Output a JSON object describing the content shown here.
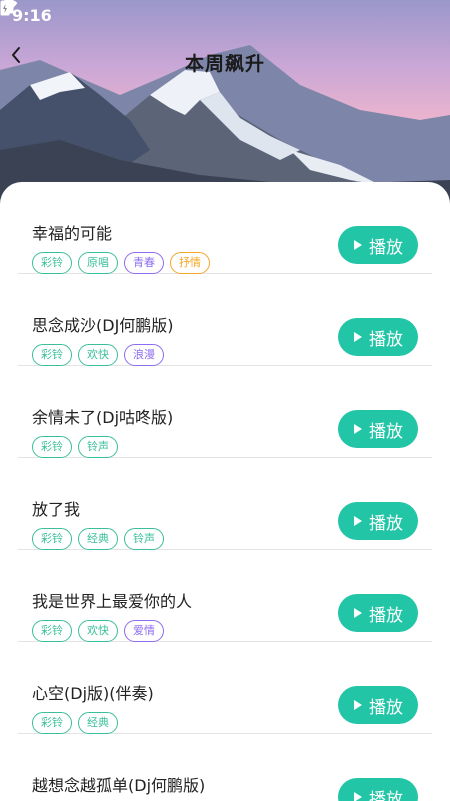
{
  "status_bar": {
    "time": "9:16",
    "icons": [
      "music-note-icon",
      "a-badge-icon",
      "wifi-icon",
      "signal-icon",
      "battery-charging-icon"
    ]
  },
  "header": {
    "title": "本周飙升",
    "back_icon": "back-arrow-icon"
  },
  "tag_colors": {
    "彩铃": "#3bbf9a",
    "原唱": "#3bbf9a",
    "青春": "#8c6cf0",
    "抒情": "#f5a623",
    "欢快": "#3bbf9a",
    "浪漫": "#8c6cf0",
    "铃声": "#3bbf9a",
    "经典": "#3bbf9a",
    "爱情": "#8c6cf0"
  },
  "songs": [
    {
      "title": "幸福的可能",
      "tags": [
        "彩铃",
        "原唱",
        "青春",
        "抒情"
      ],
      "play_label": "播放"
    },
    {
      "title": "思念成沙(DJ何鹏版)",
      "tags": [
        "彩铃",
        "欢快",
        "浪漫"
      ],
      "play_label": "播放"
    },
    {
      "title": "余情未了(Dj咕咚版)",
      "tags": [
        "彩铃",
        "铃声"
      ],
      "play_label": "播放"
    },
    {
      "title": "放了我",
      "tags": [
        "彩铃",
        "经典",
        "铃声"
      ],
      "play_label": "播放"
    },
    {
      "title": "我是世界上最爱你的人",
      "tags": [
        "彩铃",
        "欢快",
        "爱情"
      ],
      "play_label": "播放"
    },
    {
      "title": "心空(Dj版)(伴奏)",
      "tags": [
        "彩铃",
        "经典"
      ],
      "play_label": "播放"
    },
    {
      "title": "越想念越孤单(Dj何鹏版)",
      "tags": [],
      "play_label": "播放"
    }
  ],
  "colors": {
    "play_button": "#22c6a6"
  }
}
